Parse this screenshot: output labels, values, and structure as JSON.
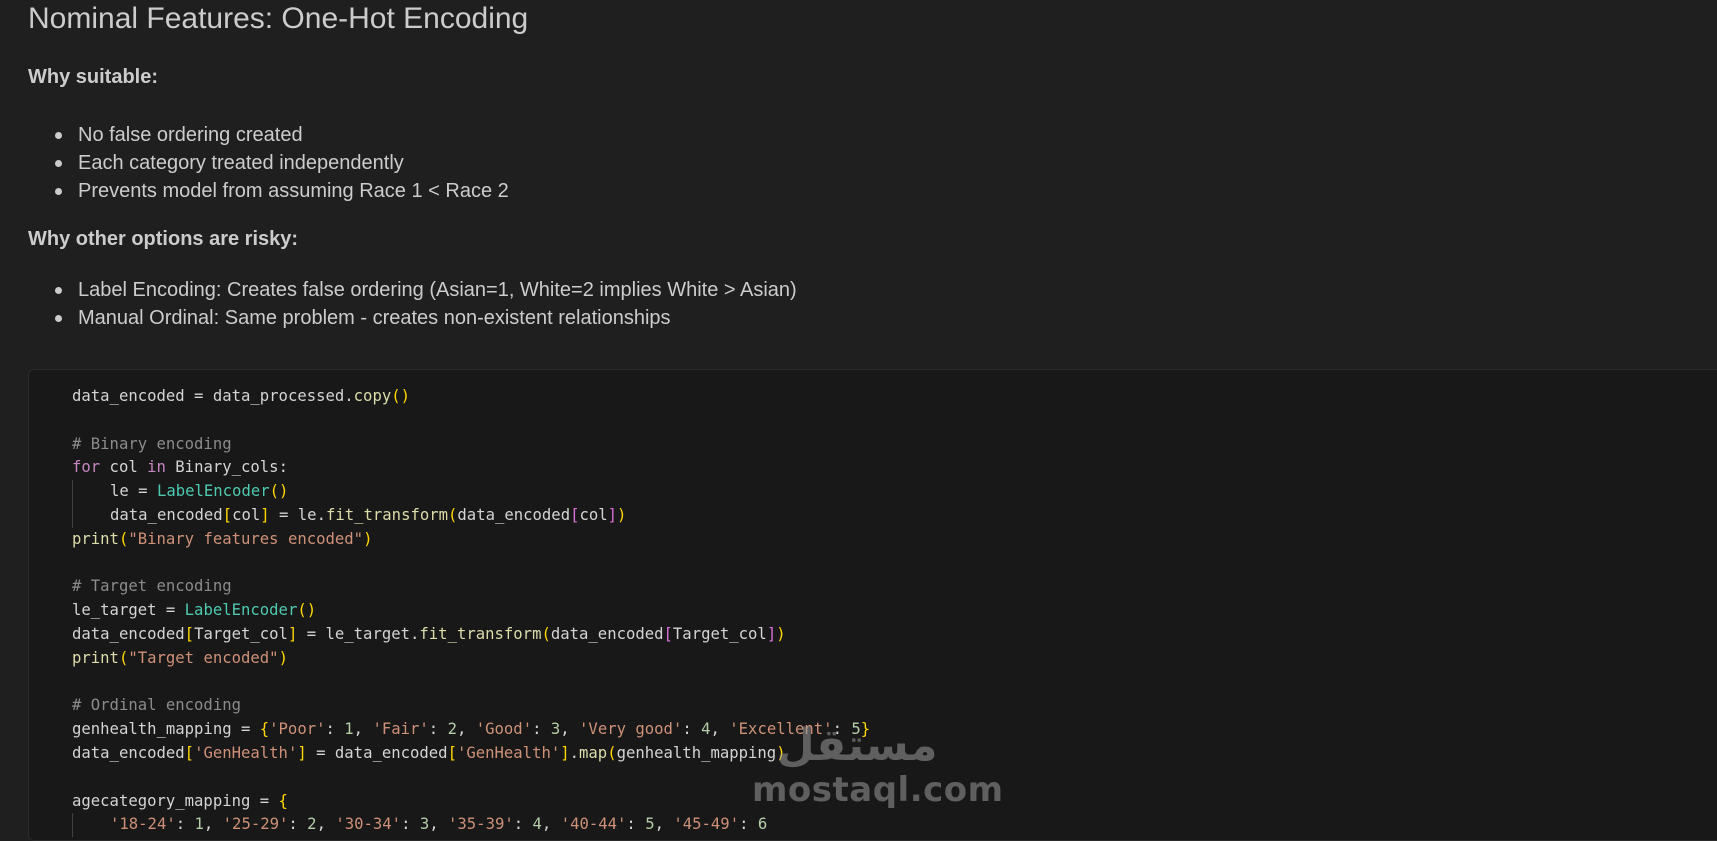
{
  "markdown": {
    "title": "Nominal Features: One-Hot Encoding",
    "why_suitable_heading": "Why suitable:",
    "why_suitable_items": [
      "No false ordering created",
      "Each category treated independently",
      "Prevents model from assuming Race 1 < Race 2"
    ],
    "why_risky_heading": "Why other options are risky:",
    "why_risky_items": [
      "Label Encoding: Creates false ordering (Asian=1, White=2 implies White > Asian)",
      "Manual Ordinal: Same problem - creates non-existent relationships"
    ]
  },
  "code": {
    "l1_var": "data_encoded",
    "l1_eq": " = ",
    "l1_obj": "data_processed",
    "l1_method": "copy",
    "comment_binary": "# Binary encoding",
    "for_kw": "for",
    "for_var": " col ",
    "in_kw": "in",
    "for_iter": " Binary_cols:",
    "le_assign": "le = ",
    "label_encoder": "LabelEncoder",
    "de_col_assign_a": "data_encoded",
    "de_col_assign_b": "col",
    "de_col_assign_c": " = le.",
    "fit_transform": "fit_transform",
    "de_col_arg_a": "data_encoded",
    "de_col_arg_b": "col",
    "print_kw": "print",
    "print_binary": "\"Binary features encoded\"",
    "comment_target": "# Target encoding",
    "le_target_assign": "le_target = ",
    "target_line_a": "data_encoded",
    "target_line_b": "Target_col",
    "target_line_c": " = le_target.",
    "print_target": "\"Target encoded\"",
    "comment_ordinal": "# Ordinal encoding",
    "genhealth_assign": "genhealth_mapping = ",
    "gh_poor": "'Poor'",
    "gh_fair": "'Fair'",
    "gh_good": "'Good'",
    "gh_vgood": "'Very good'",
    "gh_exc": "'Excellent'",
    "n1": "1",
    "n2": "2",
    "n3": "3",
    "n4": "4",
    "n5": "5",
    "n6": "6",
    "genhealth_col": "'GenHealth'",
    "map_method": "map",
    "genhealth_mapping": "genhealth_mapping",
    "agecategory_assign": "agecategory_mapping = ",
    "age_18": "'18-24'",
    "age_25": "'25-29'",
    "age_30": "'30-34'",
    "age_35": "'35-39'",
    "age_40": "'40-44'",
    "age_45": "'45-49'"
  },
  "watermark": {
    "arabic": "مستقل",
    "latin": "mostaql.com"
  }
}
